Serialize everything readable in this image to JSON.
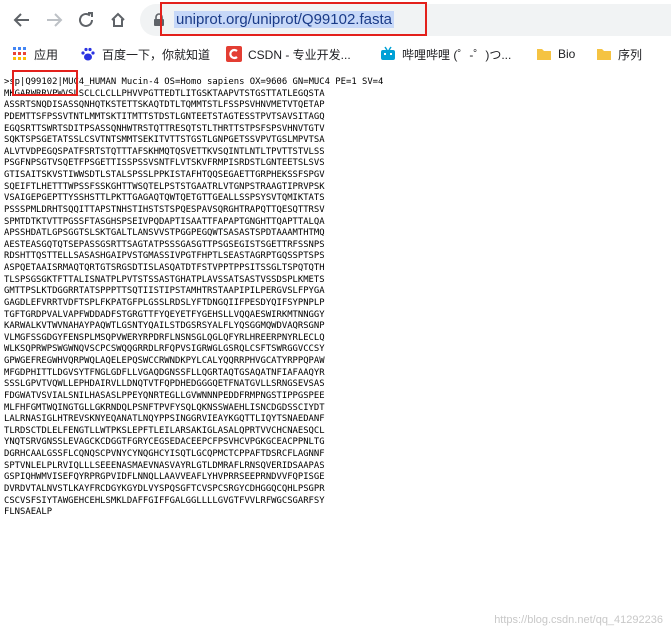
{
  "browser": {
    "url_selected": "uniprot.org/uniprot/Q99102.fasta",
    "bookmarks": [
      {
        "label": "应用",
        "icon": "apps-grid-icon"
      },
      {
        "label": "百度一下，你就知道",
        "icon": "baidu-paw-icon"
      },
      {
        "label": "CSDN - 专业开发...",
        "icon": "csdn-logo-icon"
      },
      {
        "label": "哔哩哔哩 (゜-゜)つ...",
        "icon": "bilibili-tv-icon"
      },
      {
        "label": "Bio",
        "icon": "folder-icon"
      },
      {
        "label": "序列",
        "icon": "folder-icon"
      }
    ]
  },
  "fasta": {
    "header_prefix": ">sp|",
    "accession": "Q99102",
    "header_rest": "|MUC4_HUMAN Mucin-4 OS=Homo sapiens OX=9606 GN=MUC4 PE=1 SV=4",
    "sequence_lines": [
      "MKGARWRRVPWVSLSCLCLCLLPHVVPGTTEDTLITGSKTAAPVTSTGSTTATLEGQSTA",
      "ASSRTSNQDISASSQNHQTKSTETTSKAQTDTLTQMMTSTLFSSPSVHNVMETVTQETAP",
      "PDEMTTSFPSSVTNTLMMTSKTITMTTSTDSTLGNTEETSTAGTESSTPVTSAVSITAGQ",
      "EGQSRTTSWRTSDITPSASSQNHWTRSTQTTRESQTSTLTHRTTSTPSFSPSVHNVTGTV",
      "SQKTSPSGETATSSLCSVTNTSMMTSEKITVTTSTGSTLGNPGETSSVPVTGSLMPVTSA",
      "ALVTVDPEGQSPATFSRTSTQTTTAFSKHMQTQSVETTKVSQINTLNTLTPVTTSTVLSS",
      "PSGFNPSGTVSQETFPSGETTISSPSSVSNTFLVTSKVFRMPISRDSTLGNTEETSLSVS",
      "GTISAITSKVSTIWWSDTLSTALSPSSLPPKISTAFHTQQSEGAETTGRPHEKSSFSPGV",
      "SQEIFTLHETTTWPSSFSSKGHTTWSQTELPSTSTGAATRLVTGNPSTRAAGTIPRVPSK",
      "VSAIGEPGEPTTYSSHSTTLPKTTGAGAQTQWTQETGTTGEALLSSPSYSVTQMIKTATS",
      "PSSSPMLDRHTSQQITTAPSTNHSTIHSTSTSPQESPAVSQRGHTRAPQTTQESQTTRSV",
      "SPMTDTKTVTTPGSSFTASGHSPSEIVPQDAPTISAATTFAPAPTGNGHTTQAPTTALQA",
      "APSSHDATLGPSGGTSLSKTGALTLANSVVSTPGGPEGQWTSASASTSPDTAAAMTHTMQ",
      "AESTEASGQTQTSEPASSGSRTTSAGTATPSSSGASGTTPSGSEGISTSGETTRFSSNPS",
      "RDSHTTQSTTELLSASASHGAIPVSTGMASSIVPGTFHPTLSEASTAGRPTGQSSPTSPS",
      "ASPQETAAISRMAQTQRTGTSRGSDTISLASQATDTFSTVPPTPPSITSSGLTSPQTQTH",
      "TLSPSGSGKTFTTALISNATPLPVTSTSSASTGHATPLAVSSATSASTVSSDSPLKMETS",
      "GMTTPSLKTDGGRRTATSPPPTTSQTIISTIPSTAMHTRSTAAPIPILPERGVSLFPYGA",
      "GAGDLEFVRRTVDFTSPLFKPATGFPLGSSLRDSLYFTDNGQIIFPESDYQIFSYPNPLP",
      "TGFTGRDPVALVAPFWDDADFSTGRGTTFYQEYETFYGEHSLLVQQAESWIRKMTNNGGY",
      "KARWALKVTWVNAHAYPAQWTLGSNTYQAILSTDGSRSYALFLYQSGGMQWDVAQRSGNP",
      "VLMGFSSGDGYFENSPLMSQPVWERYRPDRFLNSNSGLQGLQFYRLHREERPNYRLECLQ",
      "WLKSQPRWPSWGWNQVSCPCSWQQGRRDLRFQPVSIGRWGLGSRQLCSFTSWRGGVCCSY",
      "GPWGEFREGWHVQRPWQLAQELEPQSWCCRWNDKPYLCALYQQRRPHVGCATYRPPQPAW",
      "MFGDPHITTLDGVSYTFNGLGDFLLVGAQDGNSSFLLQGRTAQTGSAQATNFIAFAAQYR",
      "SSSLGPVTVQWLLEPHDAIRVLLDNQTVTFQPDHEDGGGQETFNATGVLLSRNGSEVSAS",
      "FDGWATVSVIALSNILHASASLPPEYQNRTEGLLGVWNNNPEDDFRMPNGSTIPPGSPEE",
      "MLFHFGMTWQINGTGLLGKRNDQLPSNFTPVFYSQLQKNSSWAEHLISNCDGDSSCIYDT",
      "LALRNASIGLHTREVSKNYEQANATLNQYPPSINGGRVIEAYKGQTTLIQYTSNAEDANF",
      "TLRDSCTDLELFENGTLLWTPKSLEPFTLEILARSAKIGLASALQPRTVVCHCNAESQCL",
      "YNQTSRVGNSSLEVAGCKCDGGTFGRYCEGSEDACEEPCFPSVHCVPGKGCEACPPNLTG",
      "DGRHCAALGSSFLCQNQSCPVNYCYNQGHCYISQTLGCQPMCTCPPAFTDSRCFLAGNNF",
      "SPTVNLELPLRVIQLLLSEEENASMAEVNASVAYRLGTLDMRAFLRNSQVERIDSAAPAS",
      "GSPIQHWMVISEFQYRPRGPVIDFLNNQLLAAVVEAFLYHVPRRSEEPRNDVVFQPISGE",
      "DVRDVTALNVSTLKAYFRCDGYKGYDLVYSPQSGFTCVSPCSRGYCDHGGQCQHLPSGPR",
      "CSCVSFSIYTAWGEHCEHLSMKLDAFFGIFFGALGGLLLLGVGTFVVLRFWGCSGARFSY",
      "FLNSAEALP"
    ]
  },
  "watermark": "https://blog.csdn.net/qq_41292236"
}
